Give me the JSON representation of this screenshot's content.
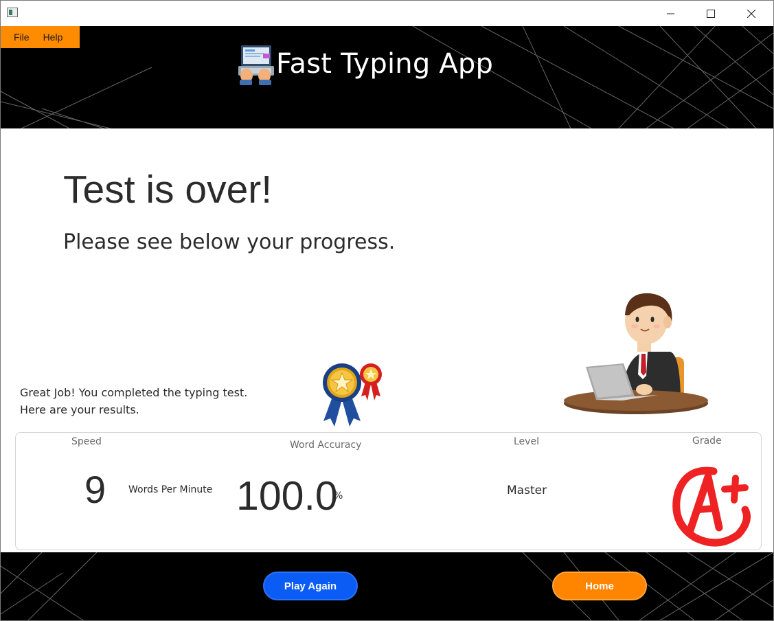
{
  "window": {
    "controls": {
      "minimize_icon": "minimize-icon",
      "maximize_icon": "maximize-icon",
      "close_icon": "close-icon"
    }
  },
  "menu": {
    "file_label": "File",
    "help_label": "Help"
  },
  "header": {
    "app_title": "Fast Typing App",
    "logo_icon": "typing-laptop-icon"
  },
  "main": {
    "heading": "Test is over!",
    "subheading": "Please see below your progress.",
    "congrats_line1": "Great Job! You completed the typing test.",
    "congrats_line2": "Here are your results.",
    "medal_icon": "award-ribbon-icon",
    "illustration": "man-at-laptop-illustration"
  },
  "results": {
    "speed_label": "Speed",
    "speed_value": "9",
    "speed_unit": "Words Per Minute",
    "accuracy_label": "Word Accuracy",
    "accuracy_value": "100.0",
    "accuracy_unit": "%",
    "level_label": "Level",
    "level_value": "Master",
    "grade_label": "Grade",
    "grade_icon": "a-plus-grade-icon"
  },
  "footer": {
    "play_again_label": "Play Again",
    "home_label": "Home"
  },
  "colors": {
    "accent_orange": "#ff8c00",
    "primary_blue": "#0a5cf5",
    "header_bg": "#000000",
    "grade_red": "#ee2222"
  }
}
